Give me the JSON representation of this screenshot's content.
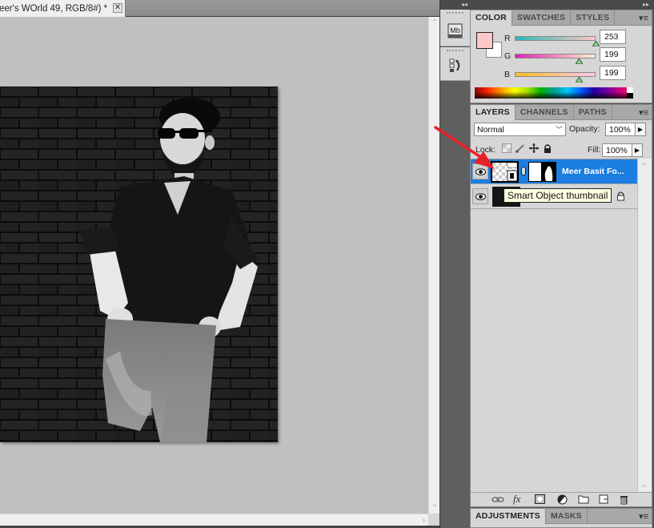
{
  "document": {
    "tab_title": "eer's WOrld 49, RGB/8#) *",
    "close_label": "✕"
  },
  "dock": {
    "collapse_glyph": "◂◂",
    "items": [
      {
        "name": "mini-bridge",
        "label": "Mb"
      },
      {
        "name": "history",
        "label": ""
      }
    ]
  },
  "panels_header": {
    "expand_glyph": "▸▸"
  },
  "color_panel": {
    "tabs": [
      "COLOR",
      "SWATCHES",
      "STYLES"
    ],
    "active_tab": "COLOR",
    "foreground_color": "#fdc7c7",
    "background_color": "#ffffff",
    "channels": [
      {
        "label": "R",
        "value": "253",
        "fraction": 0.99
      },
      {
        "label": "G",
        "value": "199",
        "fraction": 0.78
      },
      {
        "label": "B",
        "value": "199",
        "fraction": 0.78
      }
    ],
    "menu_glyph": "▾≡"
  },
  "layers_panel": {
    "tabs": [
      "LAYERS",
      "CHANNELS",
      "PATHS"
    ],
    "active_tab": "LAYERS",
    "blend_mode": "Normal",
    "opacity_label": "Opacity:",
    "opacity_value": "100%",
    "lock_label": "Lock:",
    "fill_label": "Fill:",
    "fill_value": "100%",
    "arrow_glyph": "▶",
    "menu_glyph": "▾≡",
    "layers": [
      {
        "name": "Meer Basit Fo...",
        "selected": true,
        "smart_object": true,
        "has_mask": true,
        "visible": true
      },
      {
        "name": "",
        "selected": false,
        "locked": true,
        "visible": true
      }
    ],
    "tooltip": "Smart Object thumbnail",
    "footer_icons": [
      "link-layers",
      "fx",
      "add-mask",
      "adjustment-layer",
      "new-group",
      "new-layer",
      "delete-layer"
    ],
    "fx_label": "fx"
  },
  "adjustments_panel": {
    "tabs": [
      "ADJUSTMENTS",
      "MASKS"
    ],
    "active_tab": "ADJUSTMENTS",
    "menu_glyph": "▾≡"
  },
  "accent_colors": {
    "selection_blue": "#1b7ee0",
    "annotation_red": "#e8202a"
  }
}
